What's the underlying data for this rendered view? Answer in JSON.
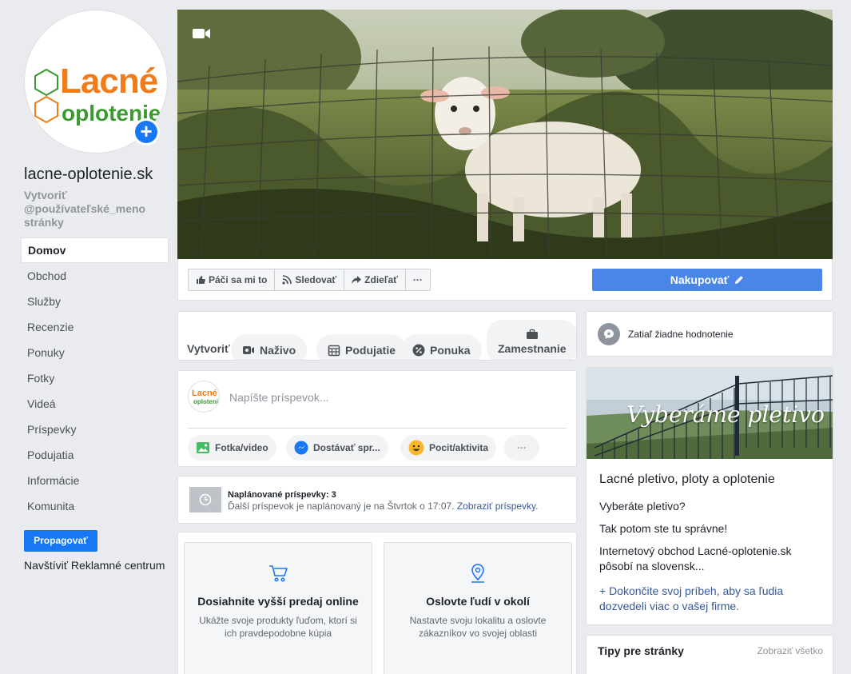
{
  "logo": {
    "line1": "Lacné",
    "line2": "oplotenie"
  },
  "page": {
    "name": "lacne-oplotenie.sk",
    "username_hint": "Vytvoriť @používateľské_meno stránky"
  },
  "nav": {
    "items": [
      {
        "label": "Domov"
      },
      {
        "label": "Obchod"
      },
      {
        "label": "Služby"
      },
      {
        "label": "Recenzie"
      },
      {
        "label": "Ponuky"
      },
      {
        "label": "Fotky"
      },
      {
        "label": "Videá"
      },
      {
        "label": "Príspevky"
      },
      {
        "label": "Podujatia"
      },
      {
        "label": "Informácie"
      },
      {
        "label": "Komunita"
      }
    ],
    "promote_label": "Propagovať",
    "ads_center_label": "Navštíviť Reklamné centrum"
  },
  "actions": {
    "like": "Páči sa mi to",
    "follow": "Sledovať",
    "share": "Zdieľať",
    "more": "···",
    "shop": "Nakupovať"
  },
  "create": {
    "label": "Vytvoriť",
    "live": "Naživo",
    "event": "Podujatie",
    "offer": "Ponuka",
    "job": "Zamestnanie"
  },
  "composer": {
    "placeholder": "Napíšte príspevok...",
    "photo": "Fotka/video",
    "messages": "Dostávať spr...",
    "feeling": "Pocit/aktivita",
    "more": "···"
  },
  "scheduled": {
    "title": "Naplánované príspevky: 3",
    "subtitle": "Ďalší príspevok je naplánovaný je na Štvrtok o 17:07.",
    "link": "Zobraziť príspevky."
  },
  "tips": [
    {
      "title": "Dosiahnite vyšší predaj online",
      "desc": "Ukážte svoje produkty ľuďom, ktorí si ich pravdepodobne kúpia",
      "icon": "cart-icon"
    },
    {
      "title": "Oslovte ľudí v okolí",
      "desc": "Nastavte svoju lokalitu a oslovte zákazníkov vo svojej oblasti",
      "icon": "location-pin-icon"
    }
  ],
  "rating": {
    "text": "Zatiaľ žiadne hodnotenie"
  },
  "story": {
    "image_text": "Vyberáme pletivo",
    "title": "Lacné pletivo, ploty a oplotenie",
    "p1": "Vyberáte pletivo?",
    "p2": "Tak potom ste tu správne!",
    "p3": "Internetový obchod Lacné-oplotenie.sk pôsobí na slovensk...",
    "link": "+ Dokončite svoj príbeh, aby sa ľudia dozvedeli viac o vašej firme."
  },
  "page_tips": {
    "title": "Tipy pre stránky",
    "link": "Zobraziť všetko"
  },
  "colors": {
    "brand_blue": "#1877f2",
    "shop_blue": "#4a86e8",
    "logo_orange": "#f07d1a",
    "logo_green": "#3b9a2f"
  }
}
